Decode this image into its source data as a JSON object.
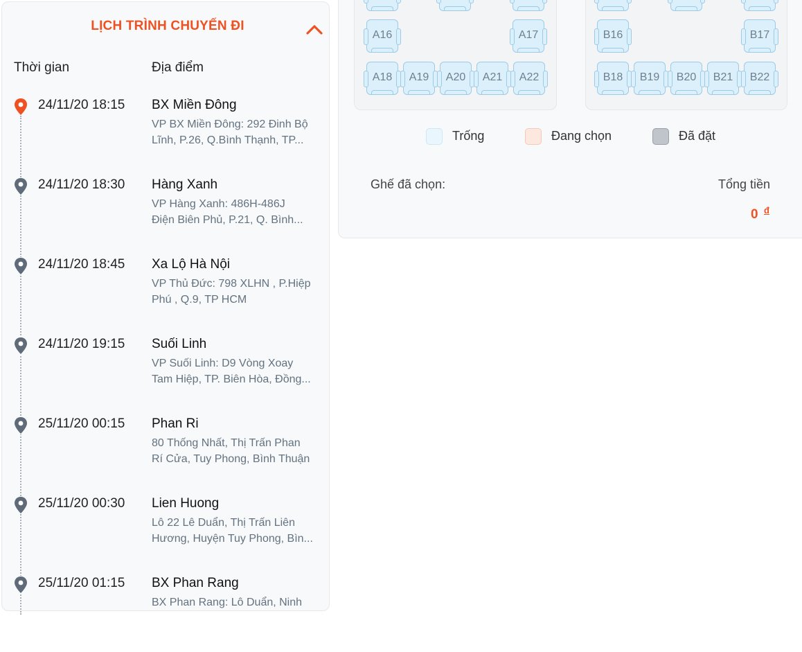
{
  "itinerary": {
    "title": "LỊCH TRÌNH CHUYẾN ĐI",
    "time_header": "Thời gian",
    "place_header": "Địa điểm",
    "stops": [
      {
        "time": "24/11/20 18:15",
        "place": "BX Miền Đông",
        "addr1": "VP BX Miền Đông: 292 Đinh Bộ",
        "addr2": "Lĩnh, P.26, Q.Bình Thạnh, TP..."
      },
      {
        "time": "24/11/20 18:30",
        "place": "Hàng Xanh",
        "addr1": "VP Hàng Xanh: 486H-486J",
        "addr2": "Điện Biên Phủ, P.21, Q. Bình..."
      },
      {
        "time": "24/11/20 18:45",
        "place": "Xa Lộ Hà Nội",
        "addr1": "VP Thủ Đức: 798 XLHN , P.Hiệp",
        "addr2": "Phú , Q.9, TP HCM"
      },
      {
        "time": "24/11/20 19:15",
        "place": "Suối Linh",
        "addr1": "VP Suối Linh: D9 Vòng Xoay",
        "addr2": "Tam Hiệp, TP. Biên Hòa, Đồng..."
      },
      {
        "time": "25/11/20 00:15",
        "place": "Phan Ri",
        "addr1": "80 Thống Nhất, Thị Trấn Phan",
        "addr2": "Rí Cửa, Tuy Phong, Bình Thuận"
      },
      {
        "time": "25/11/20 00:30",
        "place": "Lien Huong",
        "addr1": "Lô 22 Lê Duẩn, Thị Trấn Liên",
        "addr2": "Hương, Huyện Tuy Phong, Bìn..."
      },
      {
        "time": "25/11/20 01:15",
        "place": "BX Phan Rang",
        "addr1": "BX Phan Rang: Lô Duẩn, Ninh",
        "addr2": ""
      }
    ]
  },
  "seats": {
    "deck_a": [
      "A16",
      "A17",
      "A18",
      "A19",
      "A20",
      "A21",
      "A22"
    ],
    "deck_b": [
      "B16",
      "B17",
      "B18",
      "B19",
      "B20",
      "B21",
      "B22"
    ]
  },
  "legend": {
    "empty": "Trống",
    "selecting": "Đang chọn",
    "booked": "Đã đặt"
  },
  "summary": {
    "chosen_label": "Ghế đã chọn:",
    "total_label": "Tổng tiền",
    "total_value": "0",
    "currency": "đ"
  },
  "colors": {
    "accent": "#ef5222",
    "seat_empty": "#dcf0fc",
    "seat_selecting": "#fde8e0",
    "seat_booked": "#c0c4cb",
    "pin_active": "#ef5222",
    "pin_default": "#5f6b78"
  }
}
